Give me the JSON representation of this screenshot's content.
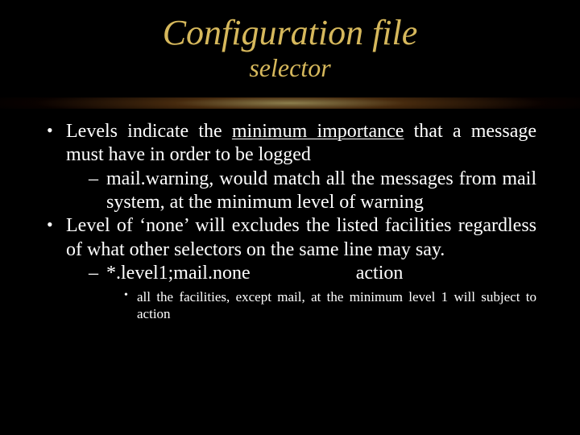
{
  "title": {
    "main": "Configuration file",
    "sub": "selector"
  },
  "bullets": [
    {
      "pre": "Levels indicate the ",
      "underlined": "minimum importance",
      "post": " that a message must have in order to be logged",
      "sub": [
        "mail.warning, would match all the messages from mail system, at the minimum level of warning"
      ]
    },
    {
      "text": "Level of ‘none’ will excludes the listed facilities regardless of what other selectors on the same line may say.",
      "sub": [
        {
          "selector": "*.level1;mail.none",
          "action": "action",
          "explain": "all the facilities, except mail, at the minimum level 1 will subject to action"
        }
      ]
    }
  ]
}
